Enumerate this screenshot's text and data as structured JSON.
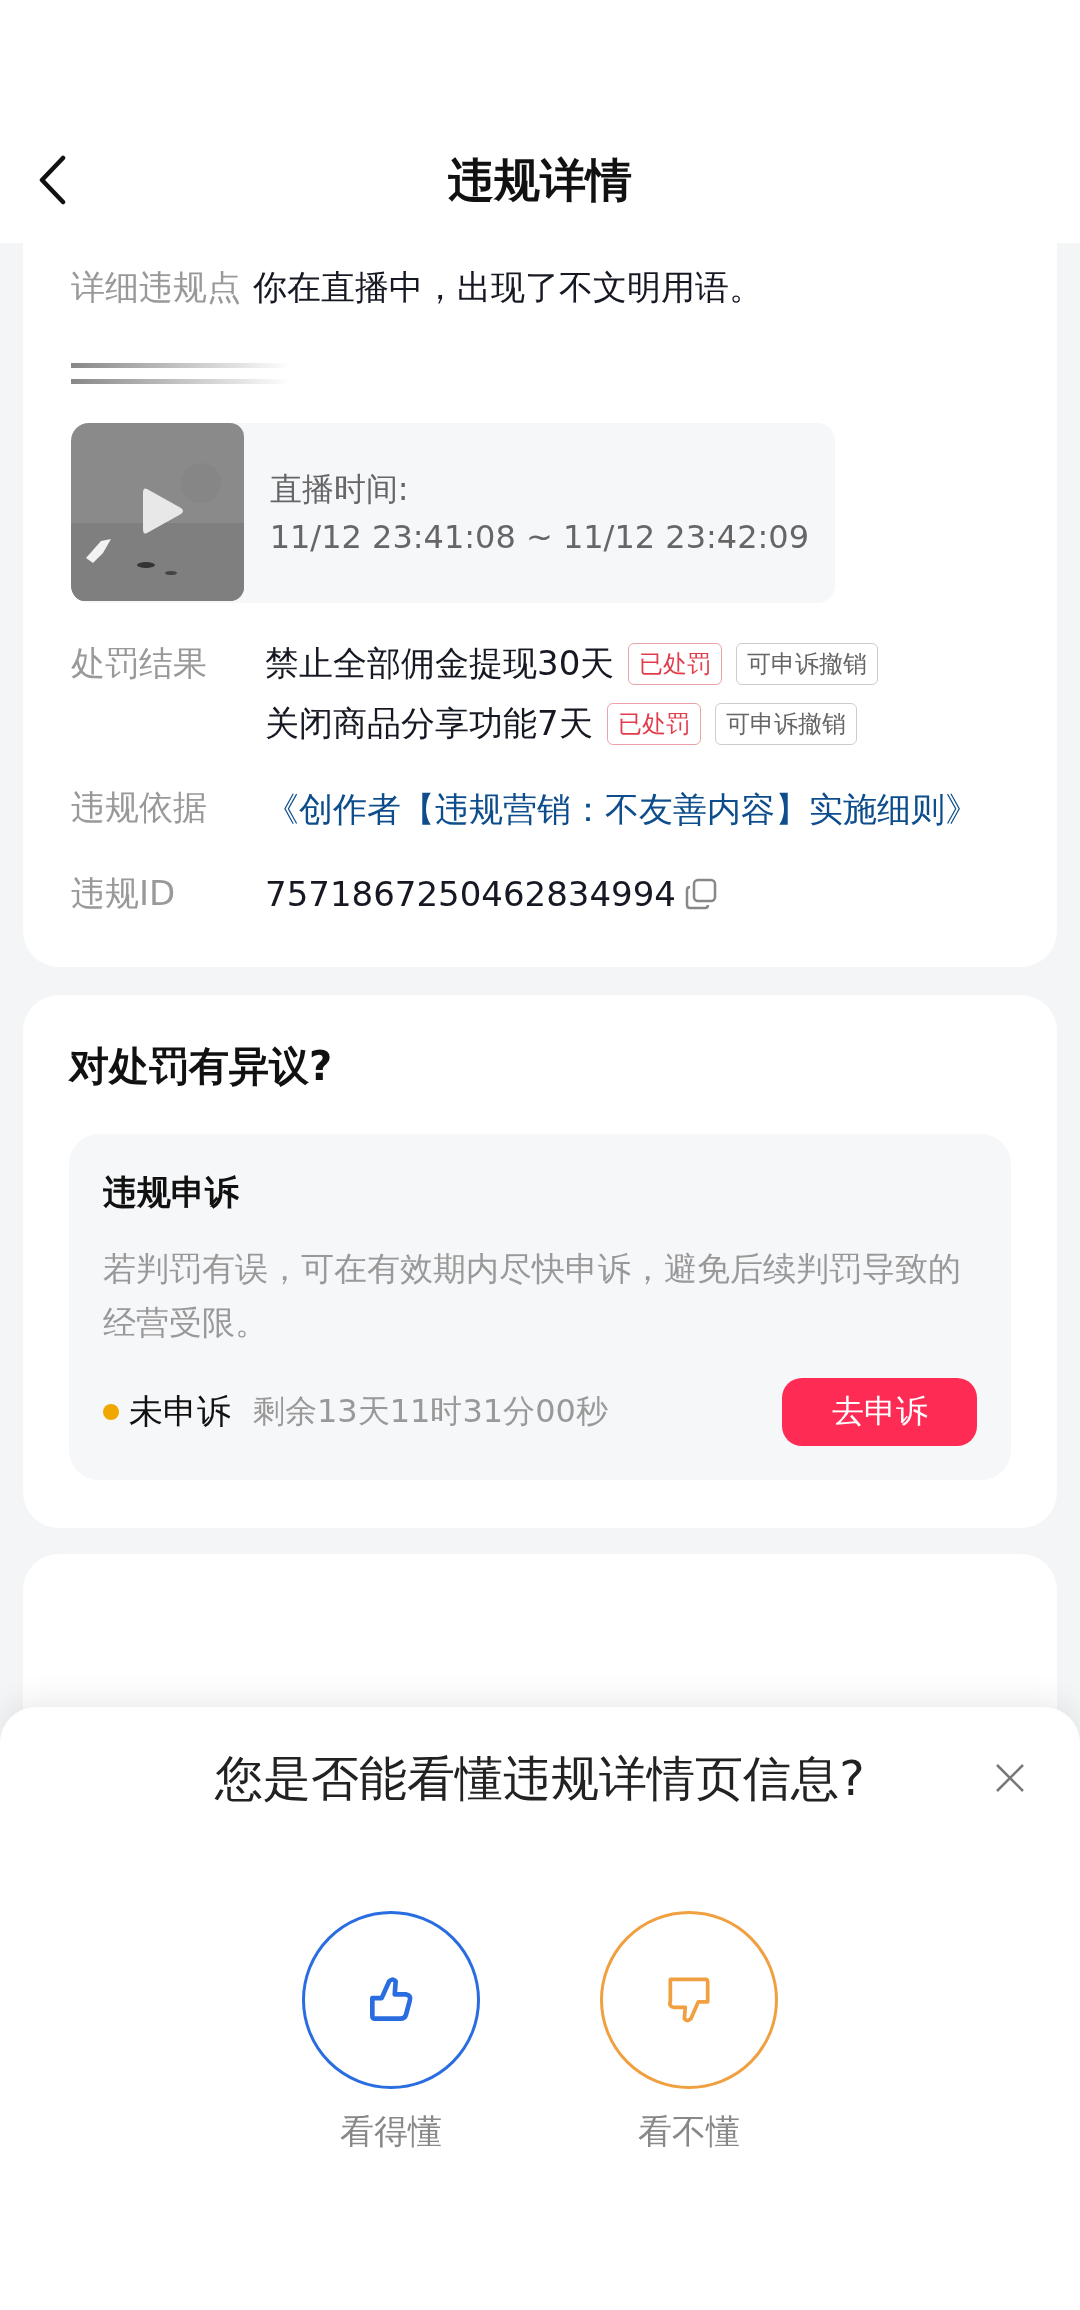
{
  "header": {
    "title": "违规详情"
  },
  "detail": {
    "label": "详细违规点",
    "value": "你在直播中，出现了不文明用语。"
  },
  "live": {
    "label": "直播时间:",
    "time": "11/12 23:41:08 ~ 11/12 23:42:09"
  },
  "penalty": {
    "label": "处罚结果",
    "items": [
      {
        "text": "禁止全部佣金提现30天",
        "tags": [
          {
            "text": "已处罚",
            "kind": "done"
          },
          {
            "text": "可申诉撤销",
            "kind": "plain"
          }
        ]
      },
      {
        "text": "关闭商品分享功能7天",
        "tags": [
          {
            "text": "已处罚",
            "kind": "done"
          },
          {
            "text": "可申诉撤销",
            "kind": "plain"
          }
        ]
      }
    ]
  },
  "basis": {
    "label": "违规依据",
    "link": "《创作者【违规营销：不友善内容】实施细则》"
  },
  "violation_id": {
    "label": "违规ID",
    "value": "7571867250462834994"
  },
  "objection": {
    "title": "对处罚有异议?",
    "appeal": {
      "title": "违规申诉",
      "description": "若判罚有误，可在有效期内尽快申诉，避免后续判罚导致的经营受限。",
      "status": {
        "text": "未申诉",
        "color": "#f0a800"
      },
      "countdown": "剩余13天11时31分00秒",
      "button": "去申诉"
    }
  },
  "survey": {
    "question": "您是否能看懂违规详情页信息?",
    "options": [
      {
        "label": "看得懂",
        "kind": "up",
        "color": "#2a6de0"
      },
      {
        "label": "看不懂",
        "kind": "down",
        "color": "#f0a040"
      }
    ]
  }
}
